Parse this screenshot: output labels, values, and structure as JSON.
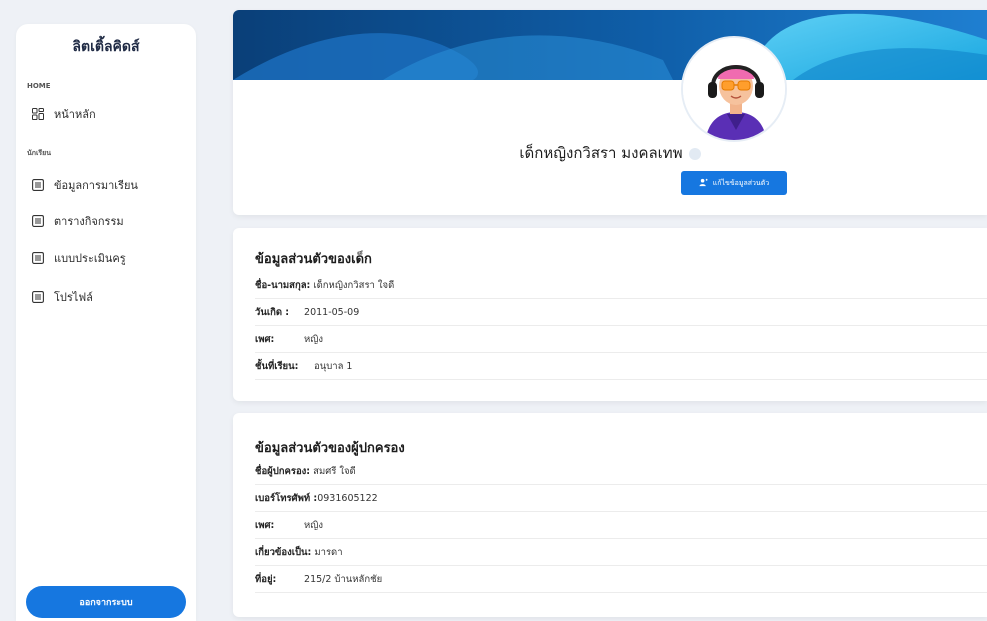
{
  "sidebar": {
    "brand": "ลิตเติ้ลคิดส์",
    "sections": [
      {
        "label": "HOME"
      },
      {
        "label": "นักเรียน"
      }
    ],
    "items": [
      {
        "label": "หน้าหลัก",
        "icon": "dashboard-icon"
      },
      {
        "label": "ข้อมูลการมาเรียน",
        "icon": "list-icon"
      },
      {
        "label": "ตารางกิจกรรม",
        "icon": "list-icon"
      },
      {
        "label": "แบบประเมินครู",
        "icon": "list-icon"
      },
      {
        "label": "โปรไฟล์",
        "icon": "list-icon"
      }
    ],
    "logout_label": "ออกจากระบบ"
  },
  "profile": {
    "full_name": "เด็กหญิงกวิสรา มงคลเทพ",
    "edit_button": "แก้ไขข้อมูลส่วนตัว"
  },
  "child_info": {
    "title": "ข้อมูลส่วนตัวของเด็ก",
    "rows": [
      {
        "label": "ชื่อ-นามสกุล:",
        "value": "เด็กหญิงกวิสรา ใจดี"
      },
      {
        "label": "วันเกิด :",
        "value": "2011-05-09"
      },
      {
        "label": "เพศ:",
        "value": "หญิง"
      },
      {
        "label": "ชั้นที่เรียน:",
        "value": "อนุบาล 1"
      }
    ]
  },
  "parent_info": {
    "title": "ข้อมูลส่วนตัวของผู้ปกครอง",
    "rows": [
      {
        "label": "ชื่อผู้ปกครอง:",
        "value": "สมศรี ใจดี"
      },
      {
        "label": "เบอร์โทรศัพท์ :",
        "value": "0931605122"
      },
      {
        "label": "เพศ:",
        "value": "หญิง"
      },
      {
        "label": "เกี่ยวข้องเป็น:",
        "value": "มารดา"
      },
      {
        "label": "ที่อยู่:",
        "value": "215/2 บ้านหลักชัย"
      }
    ]
  },
  "colors": {
    "accent": "#1677e0",
    "banner_dark": "#0d4f8f",
    "banner_light": "#4fc3f7"
  }
}
